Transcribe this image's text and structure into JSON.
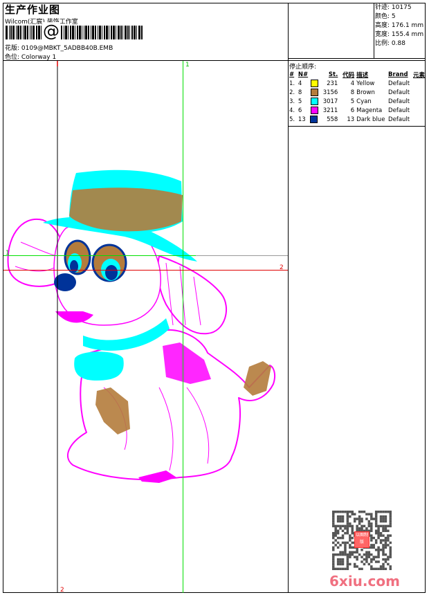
{
  "header": {
    "title": "生产作业图",
    "company": "Wilcom(汇宸) 装饰工作室",
    "barcode_symbol": "@",
    "design_label": "花版:",
    "design_value": "0109@MBKT_5ADBB40B.EMB",
    "colorway_label": "色位:",
    "colorway_value": "Colorway 1"
  },
  "info": [
    {
      "label": "针迹:",
      "value": "10175"
    },
    {
      "label": "颜色:",
      "value": "5"
    },
    {
      "label": "高度:",
      "value": "176.1 mm"
    },
    {
      "label": "宽度:",
      "value": "155.4 mm"
    },
    {
      "label": "比例:",
      "value": "0.88"
    }
  ],
  "stops": {
    "title": "停止顺序:",
    "columns": [
      "#",
      "N#",
      "St.",
      "代码",
      "描述",
      "Brand",
      "元素"
    ],
    "rows": [
      {
        "idx": "1.",
        "n": "4",
        "color": "#ffff00",
        "st": "231",
        "code": "4",
        "desc": "Yellow",
        "brand": "Default"
      },
      {
        "idx": "2.",
        "n": "8",
        "color": "#b47c3c",
        "st": "3156",
        "code": "8",
        "desc": "Brown",
        "brand": "Default"
      },
      {
        "idx": "3.",
        "n": "5",
        "color": "#00ffff",
        "st": "3017",
        "code": "5",
        "desc": "Cyan",
        "brand": "Default"
      },
      {
        "idx": "4.",
        "n": "6",
        "color": "#ff00ff",
        "st": "3211",
        "code": "6",
        "desc": "Magenta",
        "brand": "Default"
      },
      {
        "idx": "5.",
        "n": "13",
        "color": "#003399",
        "st": "558",
        "code": "13",
        "desc": "Dark blue",
        "brand": "Default"
      }
    ]
  },
  "markers": {
    "green_top": "1",
    "green_left": "1",
    "red_right": "2",
    "red_bottom": "2"
  },
  "watermark": {
    "text": "6xiu.com",
    "stamp": "以图制版"
  },
  "colors": {
    "guide_green": "#00e000",
    "guide_red": "#e00000",
    "gray_line": "#999999"
  }
}
